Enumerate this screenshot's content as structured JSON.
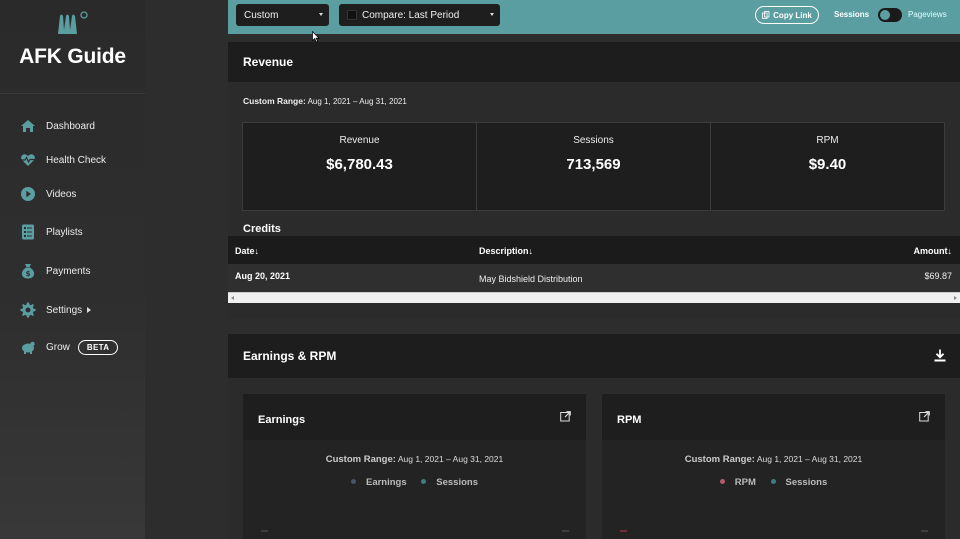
{
  "sidebar": {
    "brand": "AFK Guide",
    "items": [
      {
        "label": "Dashboard",
        "icon": "home-icon"
      },
      {
        "label": "Health Check",
        "icon": "heart-pulse-icon"
      },
      {
        "label": "Videos",
        "icon": "play-circle-icon"
      },
      {
        "label": "Playlists",
        "icon": "list-icon"
      },
      {
        "label": "Payments",
        "icon": "money-bag-icon"
      },
      {
        "label": "Settings",
        "icon": "gear-icon"
      },
      {
        "label": "Grow",
        "icon": "piggy-bank-icon",
        "badge": "BETA"
      }
    ],
    "icon_color": "#5b9ea2"
  },
  "topbar": {
    "range_select": "Custom",
    "compare_select": "Compare: Last Period",
    "copy_link": "Copy Link",
    "toggle_left": "Sessions",
    "toggle_right": "Pageviews",
    "bg_color": "#5b9ea2"
  },
  "revenue": {
    "title": "Revenue",
    "range_label": "Custom Range:",
    "range_value": "Aug 1, 2021 – Aug 31, 2021",
    "stats": [
      {
        "label": "Revenue",
        "value": "$6,780.43"
      },
      {
        "label": "Sessions",
        "value": "713,569"
      },
      {
        "label": "RPM",
        "value": "$9.40"
      }
    ]
  },
  "credits": {
    "title": "Credits",
    "columns": [
      "Date↓",
      "Description↓",
      "Amount↓"
    ],
    "rows": [
      {
        "date": "Aug 20, 2021",
        "description": "May Bidshield Distribution",
        "amount": "$69.87"
      }
    ]
  },
  "earnings_rpm": {
    "title": "Earnings & RPM",
    "cards": [
      {
        "title": "Earnings",
        "range_label": "Custom Range:",
        "range_value": "Aug 1, 2021 – Aug 31, 2021",
        "legend": [
          {
            "label": "Earnings",
            "color": "#4a5568"
          },
          {
            "label": "Sessions",
            "color": "#3f7c80"
          }
        ]
      },
      {
        "title": "RPM",
        "range_label": "Custom Range:",
        "range_value": "Aug 1, 2021 – Aug 31, 2021",
        "legend": [
          {
            "label": "RPM",
            "color": "#b65a6a"
          },
          {
            "label": "Sessions",
            "color": "#3f7c80"
          }
        ]
      }
    ]
  }
}
